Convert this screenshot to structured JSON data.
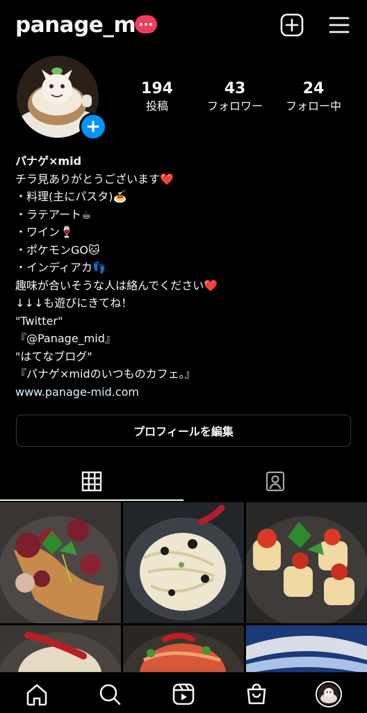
{
  "header": {
    "username": "panage_m",
    "icons": {
      "badge": "more-dots-badge",
      "create": "plus-square-icon",
      "menu": "hamburger-icon"
    }
  },
  "stats": {
    "posts": {
      "count": "194",
      "label": "投稿"
    },
    "followers": {
      "count": "43",
      "label": "フォロワー"
    },
    "following": {
      "count": "24",
      "label": "フォロー中"
    }
  },
  "bio": {
    "name": "パナゲ×mid",
    "lines": [
      "チラ見ありがとうございます❤️",
      "・料理(主にパスタ)🍝",
      "・ラテアート☕",
      "・ワイン🍷",
      "・ポケモンGO🐱",
      "・インディアカ👣",
      "趣味が合いそうな人は絡んでください❤️",
      "↓↓↓も遊びにきてね！",
      "\"Twitter\"",
      "『@Panage_mid』",
      "\"はてなブログ\"",
      "『パナゲ×midのいつものカフェ。』"
    ],
    "website": "www.panage-mid.com"
  },
  "edit_profile_label": "プロフィールを編集",
  "tabs": {
    "grid": "grid-icon",
    "tagged": "tagged-person-icon"
  },
  "nav": [
    "home-icon",
    "search-icon",
    "reels-icon",
    "shop-icon",
    "profile-avatar"
  ],
  "colors": {
    "accent": "#0095f6",
    "badge": "#ef3e5c",
    "background": "#000000"
  }
}
